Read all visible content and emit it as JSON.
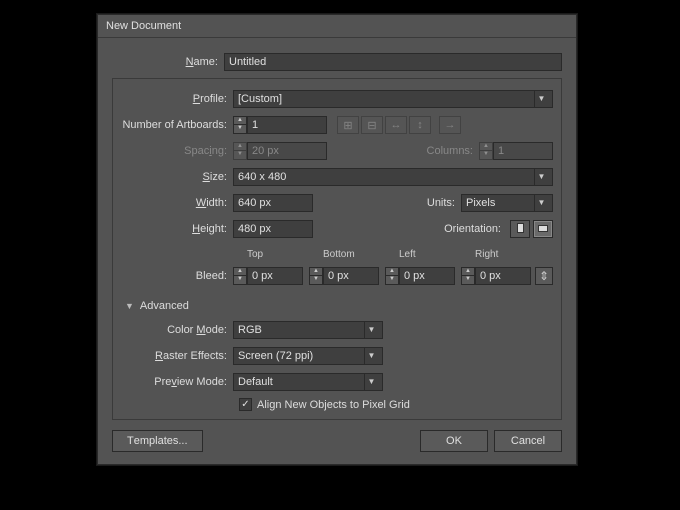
{
  "title": "New Document",
  "name": {
    "label": "Name:",
    "value": "Untitled"
  },
  "profile": {
    "label": "Profile:",
    "value": "[Custom]"
  },
  "artboards": {
    "label": "Number of Artboards:",
    "value": "1"
  },
  "spacing": {
    "label": "Spacing:",
    "value": "20 px"
  },
  "columns": {
    "label": "Columns:",
    "value": "1"
  },
  "size": {
    "label": "Size:",
    "value": "640 x 480"
  },
  "width": {
    "label": "Width:",
    "value": "640 px"
  },
  "units": {
    "label": "Units:",
    "value": "Pixels"
  },
  "height": {
    "label": "Height:",
    "value": "480 px"
  },
  "orientation": {
    "label": "Orientation:"
  },
  "bleed": {
    "label": "Bleed:",
    "top": {
      "label": "Top",
      "value": "0 px"
    },
    "bottom": {
      "label": "Bottom",
      "value": "0 px"
    },
    "left": {
      "label": "Left",
      "value": "0 px"
    },
    "right": {
      "label": "Right",
      "value": "0 px"
    }
  },
  "advanced": {
    "label": "Advanced",
    "colorMode": {
      "label": "Color Mode:",
      "value": "RGB"
    },
    "rasterEffects": {
      "label": "Raster Effects:",
      "value": "Screen (72 ppi)"
    },
    "previewMode": {
      "label": "Preview Mode:",
      "value": "Default"
    },
    "alignGrid": {
      "label": "Align New Objects to Pixel Grid",
      "checked": true
    }
  },
  "footer": {
    "templates": "Templates...",
    "ok": "OK",
    "cancel": "Cancel"
  }
}
